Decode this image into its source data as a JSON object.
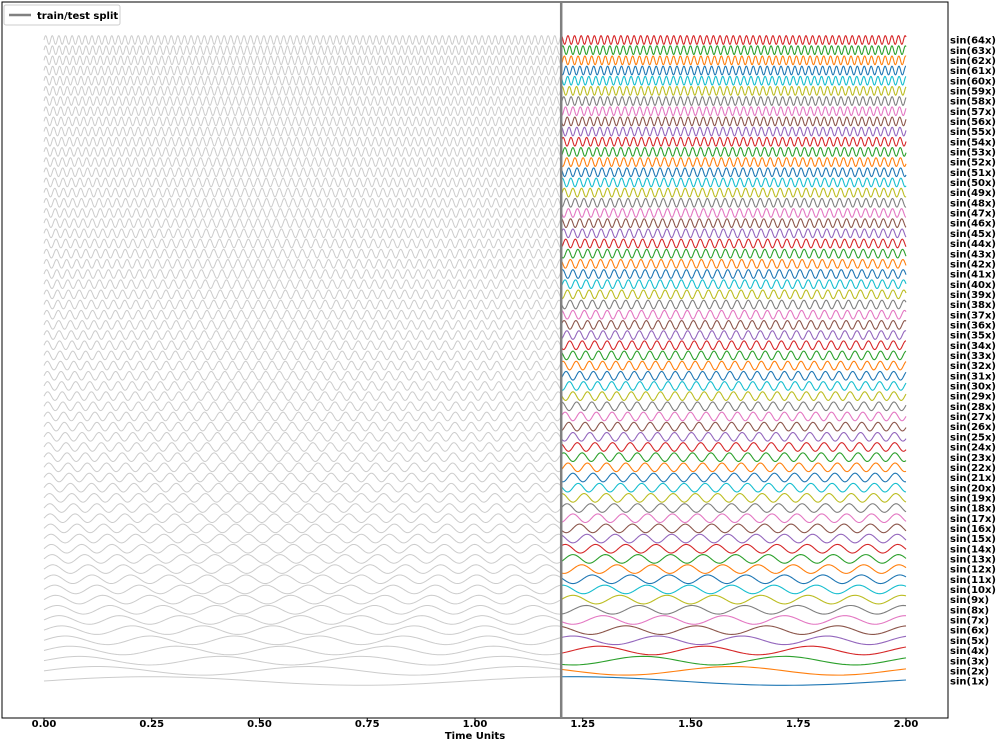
{
  "chart_data": {
    "type": "line",
    "xlabel": "Time Units",
    "xlim": [
      -0.1,
      2.1
    ],
    "x_ticks": [
      0.0,
      0.25,
      0.5,
      0.75,
      1.0,
      1.25,
      1.5,
      1.75,
      2.0
    ],
    "x_tick_labels": [
      "0.00",
      "0.25",
      "0.50",
      "0.75",
      "1.00",
      "1.25",
      "1.50",
      "1.75",
      "2.00"
    ],
    "x_range": [
      0.0,
      2.0
    ],
    "split_x": 1.2,
    "series_count": 64,
    "series_frequencies": [
      1,
      2,
      3,
      4,
      5,
      6,
      7,
      8,
      9,
      10,
      11,
      12,
      13,
      14,
      15,
      16,
      17,
      18,
      19,
      20,
      21,
      22,
      23,
      24,
      25,
      26,
      27,
      28,
      29,
      30,
      31,
      32,
      33,
      34,
      35,
      36,
      37,
      38,
      39,
      40,
      41,
      42,
      43,
      44,
      45,
      46,
      47,
      48,
      49,
      50,
      51,
      52,
      53,
      54,
      55,
      56,
      57,
      58,
      59,
      60,
      61,
      62,
      63,
      64
    ],
    "series_labels": [
      "sin(1x)",
      "sin(2x)",
      "sin(3x)",
      "sin(4x)",
      "sin(5x)",
      "sin(6x)",
      "sin(7x)",
      "sin(8x)",
      "sin(9x)",
      "sin(10x)",
      "sin(11x)",
      "sin(12x)",
      "sin(13x)",
      "sin(14x)",
      "sin(15x)",
      "sin(16x)",
      "sin(17x)",
      "sin(18x)",
      "sin(19x)",
      "sin(20x)",
      "sin(21x)",
      "sin(22x)",
      "sin(23x)",
      "sin(24x)",
      "sin(25x)",
      "sin(26x)",
      "sin(27x)",
      "sin(28x)",
      "sin(29x)",
      "sin(30x)",
      "sin(31x)",
      "sin(32x)",
      "sin(33x)",
      "sin(34x)",
      "sin(35x)",
      "sin(36x)",
      "sin(37x)",
      "sin(38x)",
      "sin(39x)",
      "sin(40x)",
      "sin(41x)",
      "sin(42x)",
      "sin(43x)",
      "sin(44x)",
      "sin(45x)",
      "sin(46x)",
      "sin(47x)",
      "sin(48x)",
      "sin(49x)",
      "sin(50x)",
      "sin(51x)",
      "sin(52x)",
      "sin(53x)",
      "sin(54x)",
      "sin(55x)",
      "sin(56x)",
      "sin(57x)",
      "sin(58x)",
      "sin(59x)",
      "sin(60x)",
      "sin(61x)",
      "sin(62x)",
      "sin(63x)",
      "sin(64x)"
    ],
    "train_color": "#cccccc",
    "split_line_color": "#808080",
    "palette": [
      "#1f77b4",
      "#ff7f0e",
      "#2ca02c",
      "#d62728",
      "#9467bd",
      "#8c564b",
      "#e377c2",
      "#7f7f7f",
      "#bcbd22",
      "#17becf"
    ],
    "legend": {
      "label": "train/test split",
      "placement": "top-left"
    },
    "grid": false
  }
}
